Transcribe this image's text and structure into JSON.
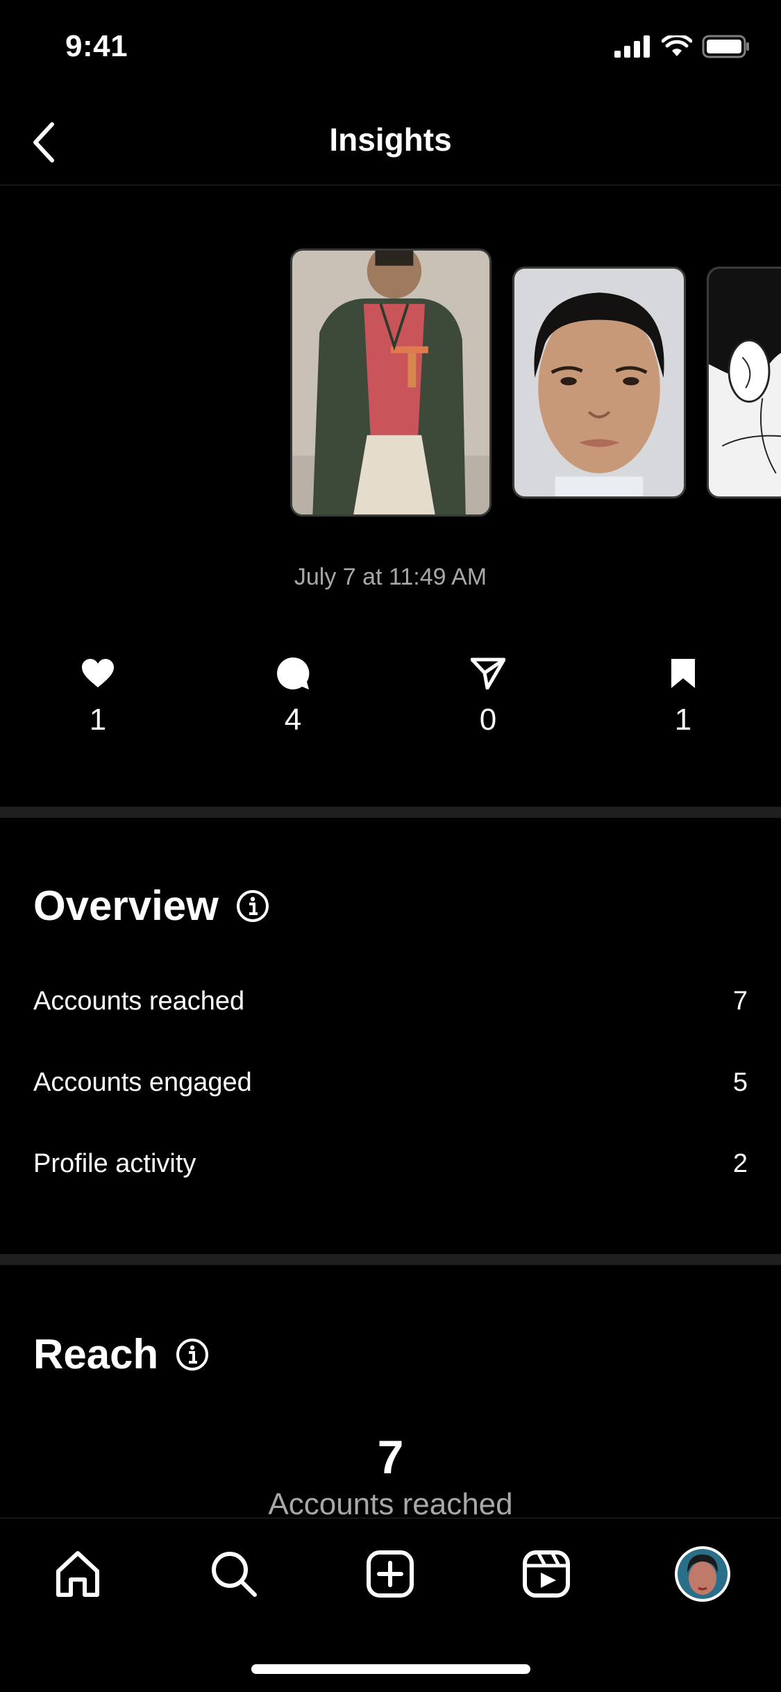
{
  "status_bar": {
    "time": "9:41"
  },
  "header": {
    "title": "Insights"
  },
  "post": {
    "date": "July 7 at 11:49 AM"
  },
  "metrics": [
    {
      "name": "likes",
      "icon": "heart-icon",
      "value": "1"
    },
    {
      "name": "comments",
      "icon": "comment-icon",
      "value": "4"
    },
    {
      "name": "shares",
      "icon": "send-icon",
      "value": "0"
    },
    {
      "name": "saves",
      "icon": "bookmark-icon",
      "value": "1"
    }
  ],
  "overview": {
    "title": "Overview",
    "rows": [
      {
        "label": "Accounts reached",
        "value": "7"
      },
      {
        "label": "Accounts engaged",
        "value": "5"
      },
      {
        "label": "Profile activity",
        "value": "2"
      }
    ]
  },
  "reach": {
    "title": "Reach",
    "count": "7",
    "label": "Accounts reached"
  },
  "tab_bar": {
    "items": [
      "home-icon",
      "search-icon",
      "create-icon",
      "reels-icon",
      "profile-avatar"
    ]
  },
  "colors": {
    "background": "#000000",
    "text": "#ffffff",
    "muted": "#a8a8a8",
    "divider": "#1f1f1f"
  }
}
